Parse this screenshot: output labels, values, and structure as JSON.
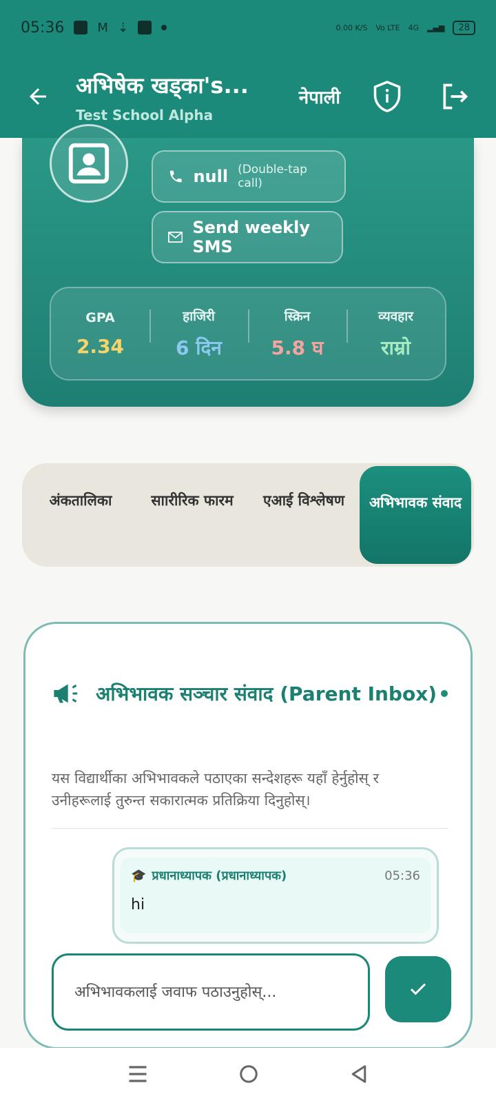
{
  "status_bar": {
    "time": "05:36",
    "net_speed": "0.00 K/S",
    "volte": "Vo LTE",
    "network": "4G",
    "battery": "28"
  },
  "header": {
    "title": "अभिषेक खड्का's...",
    "subtitle": "Test School Alpha",
    "language_label": "नेपाली"
  },
  "profile": {
    "phone_label": "null",
    "phone_hint": "(Double-tap call)",
    "sms_label": "Send weekly SMS",
    "stats": [
      {
        "label": "GPA",
        "value": "2.34",
        "color": "#f5d56b"
      },
      {
        "label": "हाजिरी",
        "value": "6 दिन",
        "color": "#8cc9f0"
      },
      {
        "label": "स्क्रिन",
        "value": "5.8 घ",
        "color": "#f4a5a0"
      },
      {
        "label": "व्यवहार",
        "value": "राम्रो",
        "color": "#a8ecc4"
      }
    ]
  },
  "tabs": [
    {
      "label": "अंकतालिका"
    },
    {
      "label": "साारीरिक फारम"
    },
    {
      "label": "एआई विश्लेषण"
    },
    {
      "label": "अभिभावक संवाद"
    }
  ],
  "inbox": {
    "title": "अभिभावक सञ्चार संवाद (Parent Inbox)",
    "description": "यस विद्यार्थीका अभिभावकले पठाएका सन्देशहरू यहाँ हेर्नुहोस् र उनीहरूलाई तुरुन्त सकारात्मक प्रतिक्रिया दिनुहोस्।",
    "message": {
      "sender": "प्रधानाध्यापक (प्रधानाध्यापक)",
      "time": "05:36",
      "text": "hi"
    },
    "reply_placeholder": "अभिभावकलाई जवाफ पठाउनुहोस्..."
  },
  "colors": {
    "primary": "#1c8a7a",
    "accent": "#1b7f72"
  }
}
